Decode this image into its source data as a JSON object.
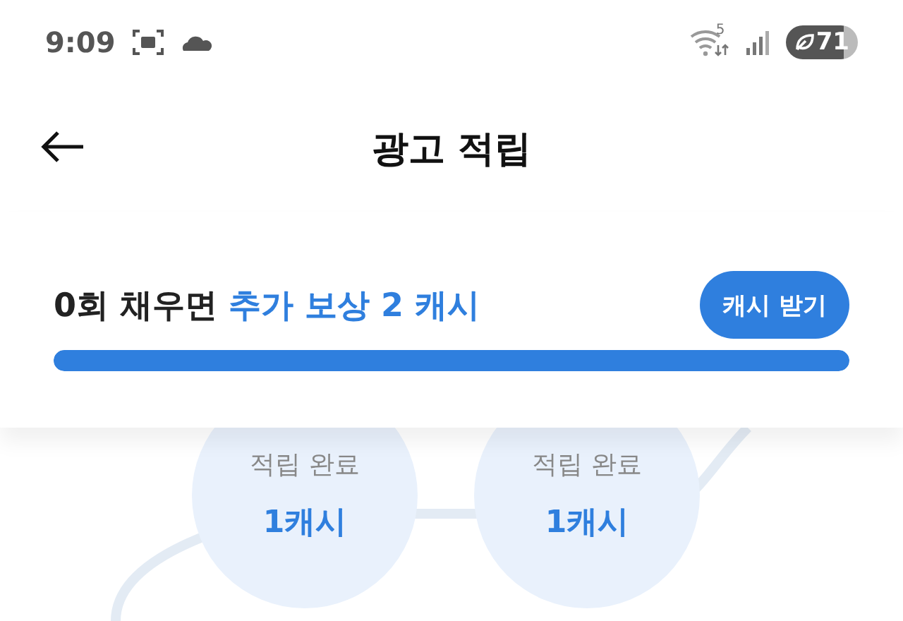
{
  "status_bar": {
    "time": "9:09",
    "wifi_badge": "5",
    "battery": "71"
  },
  "header": {
    "title": "광고 적립"
  },
  "reward": {
    "prefix": "0회 채우면",
    "highlight": "추가 보상 2 캐시",
    "button": "캐시 받기",
    "level": 1
  },
  "steps": [
    {
      "label": "적립 완료",
      "amount": "1캐시"
    },
    {
      "label": "적립 완료",
      "amount": "1캐시"
    }
  ]
}
